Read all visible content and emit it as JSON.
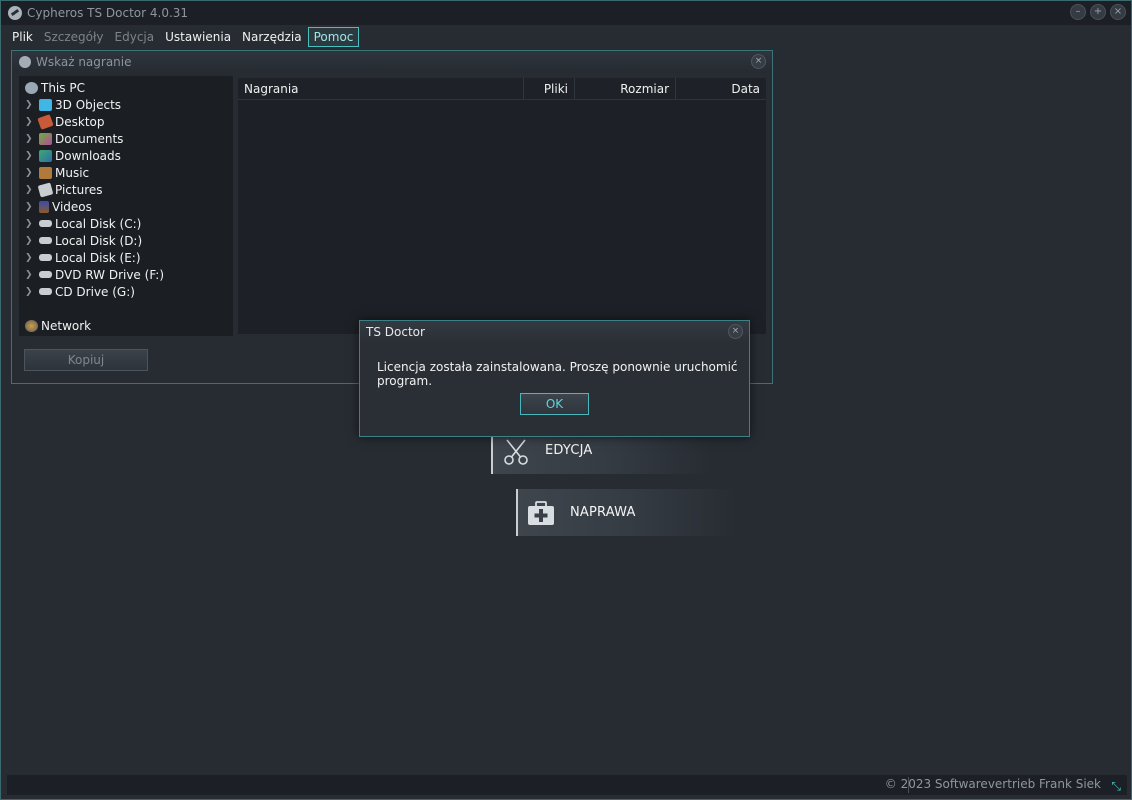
{
  "window": {
    "title": "Cypheros TS Doctor 4.0.31",
    "controls": [
      "–",
      "+",
      "×"
    ]
  },
  "menu": [
    {
      "label": "Plik",
      "state": "normal"
    },
    {
      "label": "Szczegóły",
      "state": "disabled"
    },
    {
      "label": "Edycja",
      "state": "disabled"
    },
    {
      "label": "Ustawienia",
      "state": "normal"
    },
    {
      "label": "Narzędzia",
      "state": "normal"
    },
    {
      "label": "Pomoc",
      "state": "active"
    }
  ],
  "browser": {
    "title": "Wskaż nagranie",
    "close": "×",
    "tree": [
      {
        "label": "This PC",
        "icon": "computer-icon",
        "level": 0
      },
      {
        "label": "3D Objects",
        "icon": "cube-icon",
        "level": 1
      },
      {
        "label": "Desktop",
        "icon": "desktop-icon",
        "level": 1
      },
      {
        "label": "Documents",
        "icon": "documents-icon",
        "level": 1
      },
      {
        "label": "Downloads",
        "icon": "downloads-icon",
        "level": 1
      },
      {
        "label": "Music",
        "icon": "music-icon",
        "level": 1
      },
      {
        "label": "Pictures",
        "icon": "pictures-icon",
        "level": 1
      },
      {
        "label": "Videos",
        "icon": "videos-icon",
        "level": 1
      },
      {
        "label": "Local Disk (C:)",
        "icon": "drive-icon",
        "level": 1
      },
      {
        "label": "Local Disk (D:)",
        "icon": "drive-icon",
        "level": 1
      },
      {
        "label": "Local Disk (E:)",
        "icon": "drive-icon",
        "level": 1
      },
      {
        "label": "DVD RW Drive (F:)",
        "icon": "dvd-drive-icon",
        "level": 1
      },
      {
        "label": "CD Drive (G:)",
        "icon": "cd-drive-icon",
        "level": 1
      },
      {
        "label": "Network",
        "icon": "network-icon",
        "level": 0
      }
    ],
    "columns": {
      "recordings": "Nagrania",
      "files": "Pliki",
      "size": "Rozmiar",
      "date": "Data"
    },
    "copy_label": "Kopiuj"
  },
  "actions": {
    "edit_label": "EDYCJA",
    "edit_icon": "scissors-icon",
    "repair_label": "NAPRAWA",
    "repair_icon": "first-aid-kit-icon"
  },
  "status": {
    "copyright": "© 2023 Softwarevertrieb Frank Siek"
  },
  "dialog": {
    "title": "TS Doctor",
    "close": "×",
    "message": "Licencja została zainstalowana. Proszę ponownie uruchomić program.",
    "ok_label": "OK"
  },
  "colors": {
    "accent": "#48c0c0",
    "background": "#272c33",
    "panel": "#1b1f24"
  }
}
